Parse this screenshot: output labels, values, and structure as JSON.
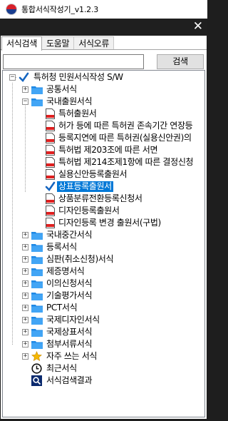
{
  "window": {
    "title": "통합서식작성기_v1.2.3",
    "close_glyph": "✕"
  },
  "tabs": [
    {
      "label": "서식검색",
      "active": true
    },
    {
      "label": "도움말",
      "active": false
    },
    {
      "label": "서식오류",
      "active": false
    }
  ],
  "search": {
    "value": "",
    "button_label": "검색"
  },
  "colors": {
    "selection": "#0078d7",
    "folder": "#1e88e5",
    "check": "#1565c0",
    "doc_red": "#e02020"
  },
  "tree": {
    "root": {
      "label": "특허청 민원서식작성 S/W",
      "expanded": true
    },
    "folder_1": {
      "label": "공통서식",
      "expanded": false
    },
    "folder_2": {
      "label": "국내출원서식",
      "expanded": true,
      "children": [
        {
          "label": "특허출원서",
          "icon": "document-icon"
        },
        {
          "label": "허가 등에 따른 특허권 존속기간 연장등",
          "icon": "document-icon"
        },
        {
          "label": "등록지연에 따른 특허권(실용신안권)의",
          "icon": "document-icon"
        },
        {
          "label": "특허법 제203조에 따른 서면",
          "icon": "document-icon"
        },
        {
          "label": "특허법 제214조제1항에 따른 결정신청",
          "icon": "document-icon"
        },
        {
          "label": "실용신안등록출원서",
          "icon": "document-icon"
        },
        {
          "label": "상표등록출원서",
          "icon": "check-icon",
          "selected": true
        },
        {
          "label": "상품분류전환등록신청서",
          "icon": "document-icon"
        },
        {
          "label": "디자인등록출원서",
          "icon": "document-icon"
        },
        {
          "label": "디자인등록 변경 출원서(구법)",
          "icon": "document-icon"
        }
      ]
    },
    "folders_rest": [
      {
        "label": "국내중간서식"
      },
      {
        "label": "등록서식"
      },
      {
        "label": "심판(취소신청)서식"
      },
      {
        "label": "제증명서식"
      },
      {
        "label": "이의신청서식"
      },
      {
        "label": "기술평가서식"
      },
      {
        "label": "PCT서식"
      },
      {
        "label": "국제디자인서식"
      },
      {
        "label": "국제상표서식"
      },
      {
        "label": "첨부서류서식"
      }
    ],
    "favorites": {
      "label": "자주 쓰는 서식"
    },
    "recent": {
      "label": "최근서식"
    },
    "search_results": {
      "label": "서식검색결과"
    }
  }
}
